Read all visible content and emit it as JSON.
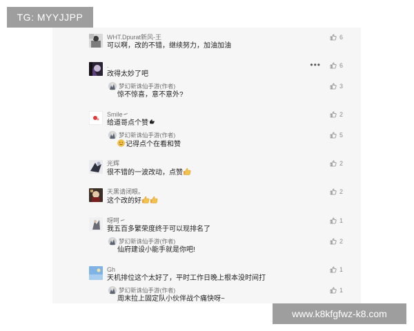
{
  "overlay": {
    "tag": "TG: MYYJJPP",
    "url": "www.k8kfgfwz-k8.com"
  },
  "icons": {
    "like": "thumb-up-outline-icon",
    "more": "more-dots-icon",
    "thumb_emoji": "thumbs-up-emoji",
    "smile_emoji": "smile-emoji",
    "point_emoji": "pointing-hand-emoji"
  },
  "colors": {
    "panel_bg": "#f6f6f6",
    "name_text": "#6f6f6f",
    "body_text": "#222222",
    "badge_bg": "#9e9e9e"
  },
  "comments": [
    {
      "name": "WHT.Dpurat新风-王",
      "text": "可以啊，改的不错，继续努力，加油加油",
      "likes": "6"
    },
    {
      "name": ".",
      "more": "•••",
      "text": "改得太妙了吧",
      "likes": "6",
      "reply": {
        "name": "梦幻新诛仙手游(作者)",
        "text": "惊不惊喜，意不意外?",
        "likes": "3"
      }
    },
    {
      "name": "Smile㇀",
      "text": "给道哥点个赞",
      "likes": "2",
      "reply": {
        "name": "梦幻新诛仙手游(作者)",
        "text": "记得点个在看和赞",
        "likes": "5"
      }
    },
    {
      "name": "光辉",
      "text": "很不错的一波改动，点赞",
      "likes": "2"
    },
    {
      "name": "天黑请闭眼。",
      "text": "这个改的好",
      "likes": "2"
    },
    {
      "name": "呀呵㇀",
      "text": "我五百多繁荣度终于可以现排名了",
      "likes": "1",
      "reply": {
        "name": "梦幻新诛仙手游(作者)",
        "text": "仙府建设小能手就是你吧!",
        "likes": "2"
      }
    },
    {
      "name": "Gh",
      "text": "天机排位这个太好了，平时工作日晚上根本没时间打",
      "likes": "1",
      "reply": {
        "name": "梦幻新诛仙手游(作者)",
        "text": "周末拉上固定队小伙伴战个痛快呀~",
        "likes": "1"
      }
    }
  ]
}
